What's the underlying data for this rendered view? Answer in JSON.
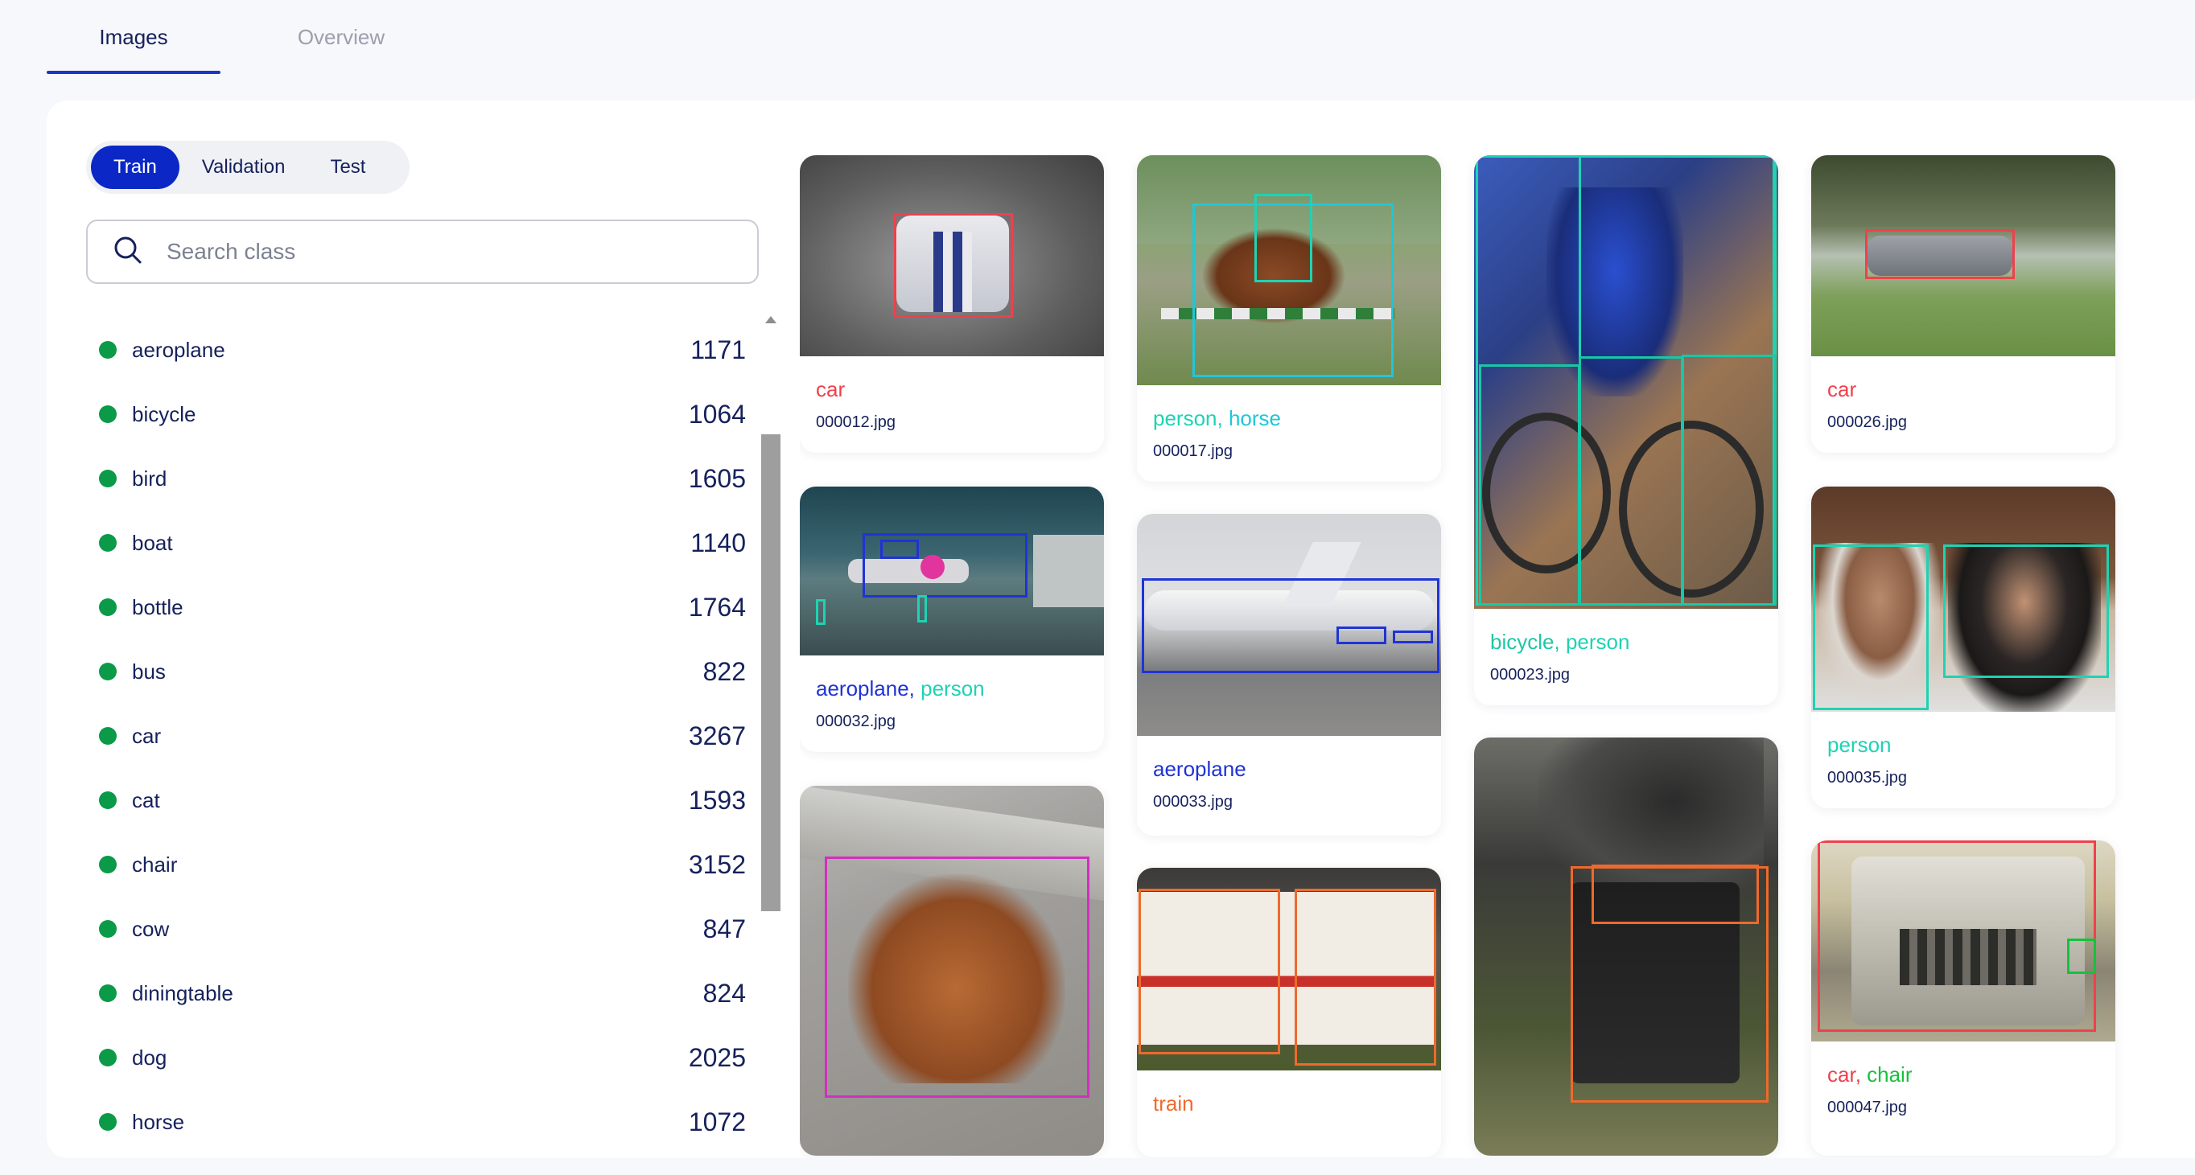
{
  "tabs": [
    {
      "label": "Images",
      "active": true
    },
    {
      "label": "Overview",
      "active": false
    }
  ],
  "splits": [
    {
      "label": "Train",
      "active": true
    },
    {
      "label": "Validation",
      "active": false
    },
    {
      "label": "Test",
      "active": false
    }
  ],
  "search": {
    "placeholder": "Search class"
  },
  "classes": [
    {
      "name": "aeroplane",
      "count": "1171"
    },
    {
      "name": "bicycle",
      "count": "1064"
    },
    {
      "name": "bird",
      "count": "1605"
    },
    {
      "name": "boat",
      "count": "1140"
    },
    {
      "name": "bottle",
      "count": "1764"
    },
    {
      "name": "bus",
      "count": "822"
    },
    {
      "name": "car",
      "count": "3267"
    },
    {
      "name": "cat",
      "count": "1593"
    },
    {
      "name": "chair",
      "count": "3152"
    },
    {
      "name": "cow",
      "count": "847"
    },
    {
      "name": "diningtable",
      "count": "824"
    },
    {
      "name": "dog",
      "count": "2025"
    },
    {
      "name": "horse",
      "count": "1072"
    }
  ],
  "colors": {
    "accent": "#0b28c6",
    "dot": "#0a9a48",
    "car": "#f0404c",
    "person": "#1ed3b4",
    "horse": "#1ec7d8",
    "aeroplane": "#1f33d6",
    "train": "#ee6a2c",
    "chair": "#16c13c",
    "dog": "#d22fc0",
    "bicycle": "#17c8a6"
  },
  "images": [
    {
      "file": "000012.jpg",
      "labels": [
        {
          "text": "car",
          "color": "#f0404c"
        }
      ]
    },
    {
      "file": "000032.jpg",
      "labels": [
        {
          "text": "aeroplane",
          "color": "#1f33d6"
        },
        {
          "text": "person",
          "color": "#1ed3b4"
        }
      ]
    },
    {
      "file": "",
      "labels": []
    },
    {
      "file": "000017.jpg",
      "labels": [
        {
          "text": "person",
          "color": "#1ed3b4"
        },
        {
          "text": "horse",
          "color": "#1ec7d8"
        }
      ]
    },
    {
      "file": "000033.jpg",
      "labels": [
        {
          "text": "aeroplane",
          "color": "#1f33d6"
        }
      ]
    },
    {
      "file": "",
      "labels": [
        {
          "text": "train",
          "color": "#ee6a2c"
        }
      ]
    },
    {
      "file": "000023.jpg",
      "labels": [
        {
          "text": "bicycle",
          "color": "#1ec7a6"
        },
        {
          "text": "person",
          "color": "#1ed3b4"
        }
      ]
    },
    {
      "file": "",
      "labels": []
    },
    {
      "file": "000026.jpg",
      "labels": [
        {
          "text": "car",
          "color": "#f0404c"
        }
      ]
    },
    {
      "file": "000035.jpg",
      "labels": [
        {
          "text": "person",
          "color": "#1ed3b4"
        }
      ]
    },
    {
      "file": "000047.jpg",
      "labels": [
        {
          "text": "car",
          "color": "#f0404c"
        },
        {
          "text": "chair",
          "color": "#16c13c"
        }
      ]
    }
  ]
}
